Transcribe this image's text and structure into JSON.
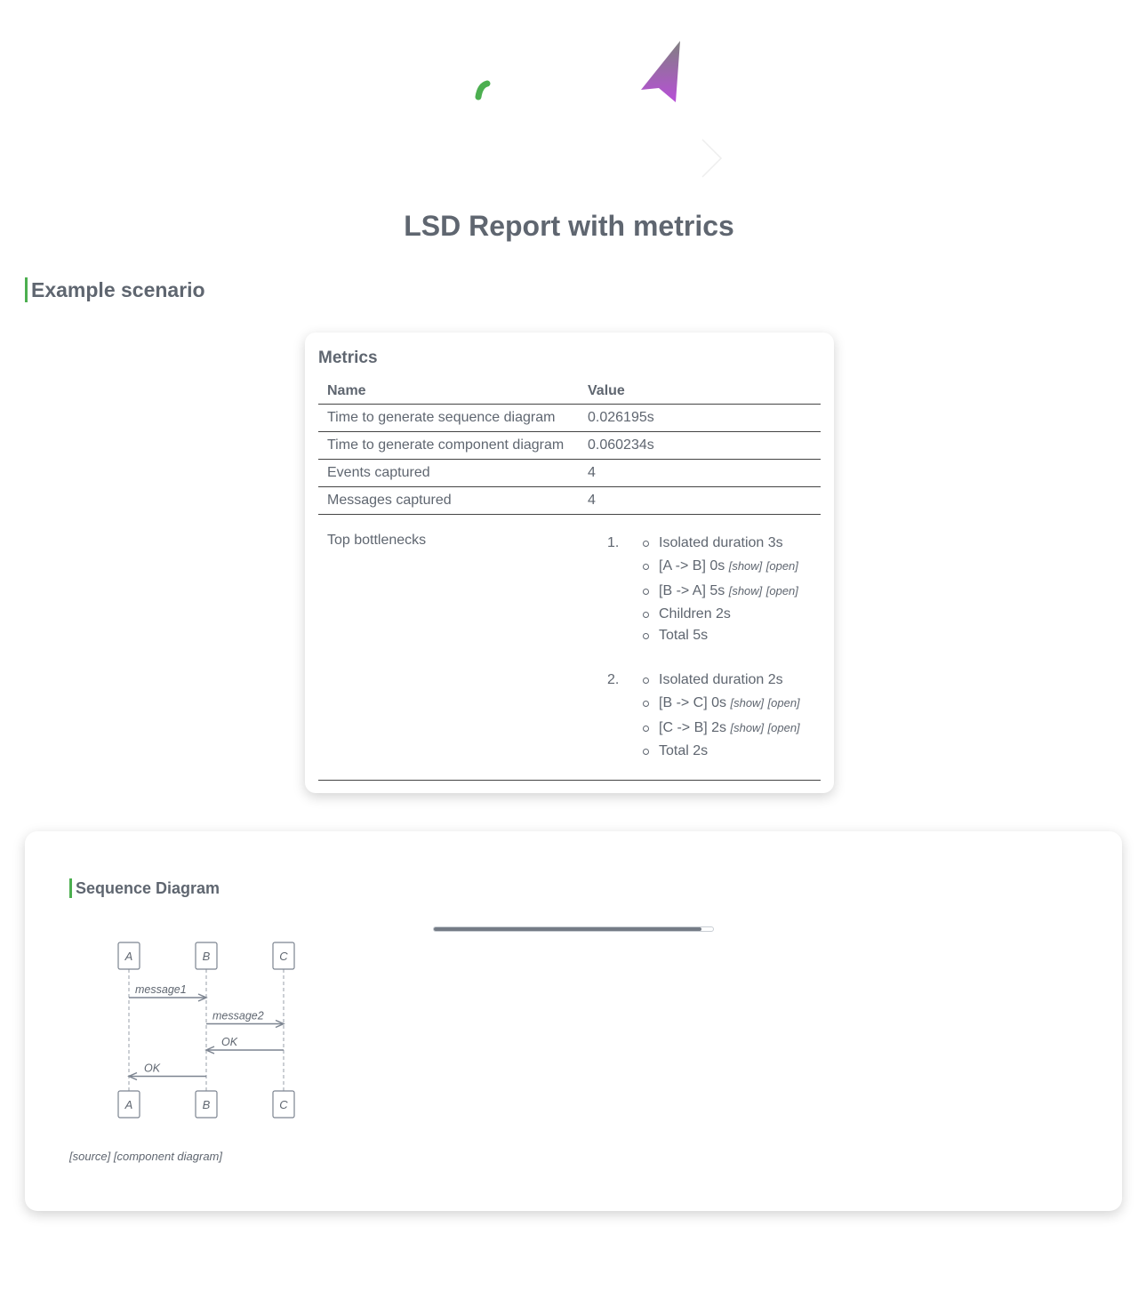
{
  "page": {
    "title": "LSD Report with metrics"
  },
  "scenario": {
    "heading": "Example scenario"
  },
  "metrics": {
    "title": "Metrics",
    "headers": {
      "name": "Name",
      "value": "Value"
    },
    "rows": [
      {
        "name": "Time to generate sequence diagram",
        "value": "0.026195s"
      },
      {
        "name": "Time to generate component diagram",
        "value": "0.060234s"
      },
      {
        "name": "Events captured",
        "value": "4"
      },
      {
        "name": "Messages captured",
        "value": "4"
      }
    ],
    "bottlenecks": {
      "label": "Top bottlenecks",
      "items": [
        {
          "number": "1.",
          "isolated": "Isolated duration 3s",
          "messages": [
            {
              "text": "[A -> B] 0s",
              "show": "[show]",
              "open": "[open]"
            },
            {
              "text": "[B -> A] 5s",
              "show": "[show]",
              "open": "[open]"
            }
          ],
          "children": "Children 2s",
          "total": "Total 5s"
        },
        {
          "number": "2.",
          "isolated": "Isolated duration 2s",
          "messages": [
            {
              "text": "[B -> C] 0s",
              "show": "[show]",
              "open": "[open]"
            },
            {
              "text": "[C -> B] 2s",
              "show": "[show]",
              "open": "[open]"
            }
          ],
          "total": "Total 2s"
        }
      ]
    }
  },
  "sequence": {
    "heading": "Sequence Diagram",
    "progress": 0.96,
    "participants": [
      "A",
      "B",
      "C"
    ],
    "messages": [
      {
        "from": "A",
        "to": "B",
        "label": "message1",
        "reply": false
      },
      {
        "from": "B",
        "to": "C",
        "label": "message2",
        "reply": false
      },
      {
        "from": "C",
        "to": "B",
        "label": "OK",
        "reply": true
      },
      {
        "from": "B",
        "to": "A",
        "label": "OK",
        "reply": true
      }
    ],
    "links": {
      "source": "[source]",
      "component": "[component diagram]"
    }
  },
  "colors": {
    "accent": "#4caf50",
    "text": "#5f6670",
    "arrow_gradient": [
      "#8a8a8a",
      "#b44fd6"
    ]
  }
}
